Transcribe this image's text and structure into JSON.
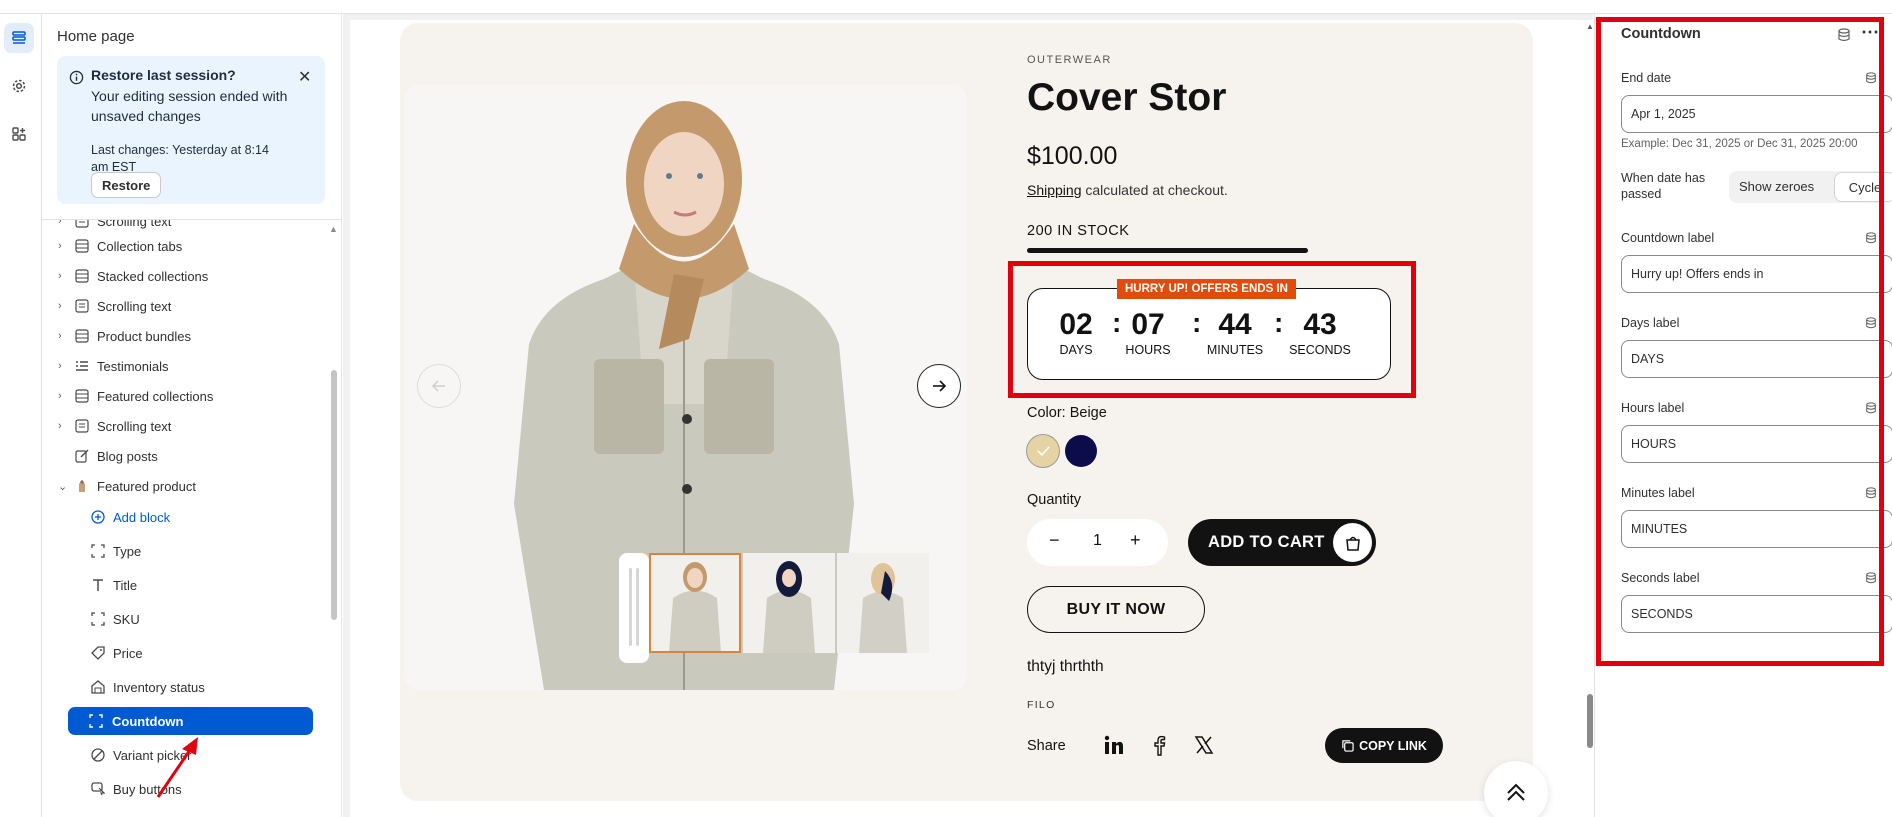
{
  "sidebar": {
    "title": "Home page",
    "banner": {
      "heading": "Restore last session?",
      "message": "Your editing session ended with unsaved changes",
      "last_changes": "Last changes: Yesterday at 8:14 am EST",
      "restore_label": "Restore"
    },
    "tree": [
      {
        "label": "Scrolling text",
        "icon": "text-block-icon",
        "expandable": true
      },
      {
        "label": "Collection tabs",
        "icon": "section-icon",
        "expandable": true
      },
      {
        "label": "Stacked collections",
        "icon": "section-icon",
        "expandable": true
      },
      {
        "label": "Scrolling text",
        "icon": "text-block-icon",
        "expandable": true
      },
      {
        "label": "Product bundles",
        "icon": "section-icon",
        "expandable": true
      },
      {
        "label": "Testimonials",
        "icon": "list-icon",
        "expandable": true
      },
      {
        "label": "Featured collections",
        "icon": "section-icon",
        "expandable": true
      },
      {
        "label": "Scrolling text",
        "icon": "text-block-icon",
        "expandable": true
      },
      {
        "label": "Blog posts",
        "icon": "edit-icon",
        "expandable": false
      },
      {
        "label": "Featured product",
        "icon": "product-icon",
        "expandable": true,
        "expanded": true
      }
    ],
    "blocks": {
      "add_block": "Add block",
      "items": [
        "Type",
        "Title",
        "SKU",
        "Price",
        "Inventory status",
        "Countdown",
        "Variant picker",
        "Buy buttons"
      ],
      "selected": "Countdown"
    }
  },
  "product": {
    "eyebrow": "OUTERWEAR",
    "title": "Cover Stor",
    "price": "$100.00",
    "shipping_link": "Shipping",
    "shipping_text": "calculated at checkout.",
    "stock": "200 IN STOCK",
    "countdown": {
      "badge": "HURRY UP! OFFERS ENDS IN",
      "days": "02",
      "days_label": "DAYS",
      "hours": "07",
      "hours_label": "HOURS",
      "minutes": "44",
      "minutes_label": "MINUTES",
      "seconds": "43",
      "seconds_label": "SECONDS",
      "separator": ":"
    },
    "color_label": "Color: Beige",
    "swatches": [
      "#e6d3a3",
      "#0c0c4a"
    ],
    "quantity_label": "Quantity",
    "quantity": "1",
    "qty_minus": "−",
    "qty_plus": "+",
    "add_to_cart": "ADD TO CART",
    "buy_now": "BUY IT NOW",
    "description": "thtyj thrthth",
    "vendor": "FILO",
    "share_label": "Share",
    "copy_link": "COPY LINK"
  },
  "settings": {
    "title": "Countdown",
    "end_date_label": "End date",
    "end_date_value": "Apr 1, 2025",
    "end_date_hint": "Example: Dec 31, 2025 or Dec 31, 2025 20:00",
    "when_passed_label": "When date has passed",
    "option_show_zeroes": "Show zeroes",
    "option_cycle": "Cycle",
    "selected_option": "Cycle",
    "countdown_label_label": "Countdown label",
    "countdown_label_value": "Hurry up! Offers ends in",
    "days_label_label": "Days label",
    "days_label_value": "DAYS",
    "hours_label_label": "Hours label",
    "hours_label_value": "HOURS",
    "minutes_label_label": "Minutes label",
    "minutes_label_value": "MINUTES",
    "seconds_label_label": "Seconds label",
    "seconds_label_value": "SECONDS"
  },
  "colors": {
    "accent": "#005bd3",
    "highlight": "#e0000e",
    "badge": "#e14b0c",
    "card_bg": "#f6f3ef"
  }
}
